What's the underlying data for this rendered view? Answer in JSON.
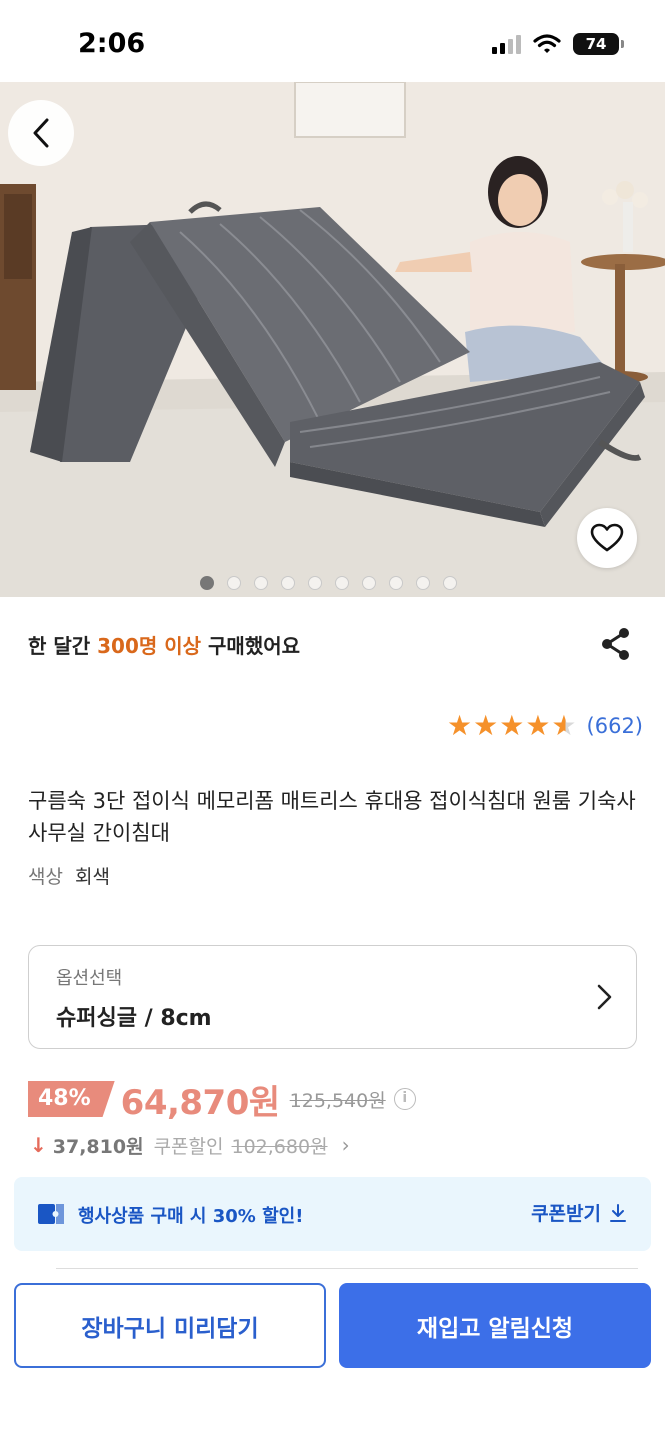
{
  "status_bar": {
    "time": "2:06",
    "battery": "74"
  },
  "hero": {
    "image_count": 10,
    "active_index": 0
  },
  "social_proof": {
    "prefix": "한 달간 ",
    "highlight": "300명 이상",
    "suffix": " 구매했어요"
  },
  "rating": {
    "stars": 4.5,
    "count_text": "(662)"
  },
  "product": {
    "title": "구름숙 3단 접이식 메모리폼 매트리스 휴대용 접이식침대 원룸 기숙사 사무실 간이침대",
    "color_label": "색상",
    "color_value": "회색"
  },
  "option": {
    "label": "옵션선택",
    "value": "슈퍼싱글 / 8cm"
  },
  "price": {
    "discount": "48%",
    "sale": "64,870원",
    "original": "125,540원",
    "info_icon": "i"
  },
  "coupon": {
    "arrow": "↓",
    "price": "37,810원",
    "label": "쿠폰할인",
    "original": "102,680원",
    "chevron": "›"
  },
  "promo": {
    "text": "행사상품 구매 시 30% 할인!",
    "button": "쿠폰받기"
  },
  "actions": {
    "cart": "장바구니 미리담기",
    "restock": "재입고 알림신청"
  },
  "colors": {
    "accent": "#3c6fe8",
    "discount": "#e88b7c",
    "highlight": "#d9681b",
    "promo_bg": "#eaf6fd"
  }
}
